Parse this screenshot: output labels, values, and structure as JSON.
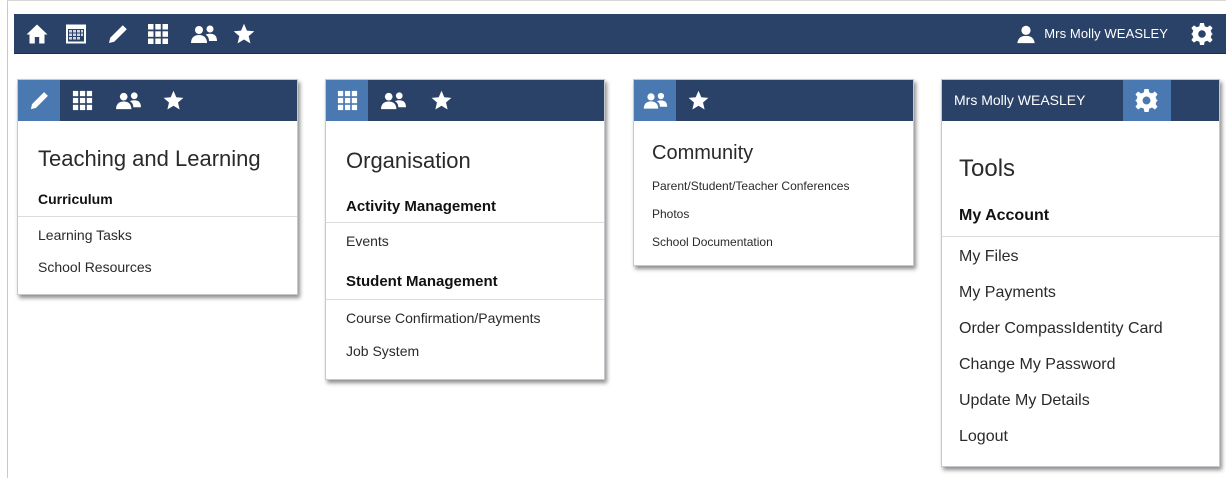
{
  "topbar": {
    "icons": [
      "home-icon",
      "calendar-icon",
      "pencil-icon",
      "grid-icon",
      "people-icon",
      "star-icon"
    ],
    "user_name": "Mrs Molly WEASLEY",
    "user_icon": "user-icon",
    "settings_icon": "gear-icon"
  },
  "panels": {
    "teaching": {
      "title": "Teaching and Learning",
      "section": "Curriculum",
      "items": [
        "Learning Tasks",
        "School Resources"
      ]
    },
    "organisation": {
      "title": "Organisation",
      "sections": [
        {
          "heading": "Activity Management",
          "items": [
            "Events"
          ]
        },
        {
          "heading": "Student Management",
          "items": [
            "Course Confirmation/Payments",
            "Job System"
          ]
        }
      ]
    },
    "community": {
      "title": "Community",
      "items": [
        "Parent/Student/Teacher Conferences",
        "Photos",
        "School Documentation"
      ]
    },
    "tools": {
      "header_name": "Mrs Molly WEASLEY",
      "title": "Tools",
      "section": "My Account",
      "items": [
        "My Files",
        "My Payments",
        "Order CompassIdentity Card",
        "Change My Password",
        "Update My Details",
        "Logout"
      ]
    }
  },
  "colors": {
    "nav_bg": "#2b4268",
    "nav_highlight": "#4a79b2",
    "panel_border": "#c5c8cd"
  }
}
